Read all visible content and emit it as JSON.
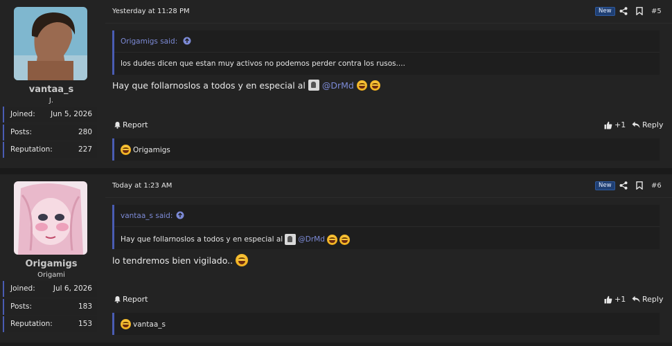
{
  "posts": [
    {
      "user": {
        "name": "vantaa_s",
        "title": "J.",
        "stats": [
          {
            "label": "Joined:",
            "value": "Jun 5, 2026"
          },
          {
            "label": "Posts:",
            "value": "280"
          },
          {
            "label": "Reputation:",
            "value": "227"
          }
        ]
      },
      "date": "Yesterday at 11:28 PM",
      "badge": "New",
      "number": "#5",
      "quote": {
        "author": "Origamigs said:",
        "text": "los dudes dicen que estan muy activos no podemos perder contra los rusos...."
      },
      "message": {
        "text": "Hay que follarnoslos a todos y en especial al",
        "mention": "@DrMd"
      },
      "actions": {
        "report": "Report",
        "like": "+1",
        "reply": "Reply"
      },
      "reaction_user": "Origamigs"
    },
    {
      "user": {
        "name": "Origamigs",
        "title": "Origami",
        "stats": [
          {
            "label": "Joined:",
            "value": "Jul 6, 2026"
          },
          {
            "label": "Posts:",
            "value": "183"
          },
          {
            "label": "Reputation:",
            "value": "153"
          }
        ]
      },
      "date": "Today at 1:23 AM",
      "badge": "New",
      "number": "#6",
      "quote": {
        "author": "vantaa_s said:",
        "text": "Hay que follarnoslos a todos y en especial al",
        "mention": "@DrMd"
      },
      "message": {
        "text": "lo tendremos bien vigilado.."
      },
      "actions": {
        "report": "Report",
        "like": "+1",
        "reply": "Reply"
      },
      "reaction_user": "vantaa_s"
    }
  ],
  "icons": {
    "share": "share-icon",
    "bookmark": "bookmark-icon",
    "report": "bell-icon",
    "like": "thumbs-up-icon",
    "reply": "reply-arrow-icon",
    "reaction": "laughing-emoji-icon"
  },
  "colors": {
    "accent": "#4a5cb3",
    "link": "#7c8ad6",
    "badge": "#1f3f73"
  }
}
